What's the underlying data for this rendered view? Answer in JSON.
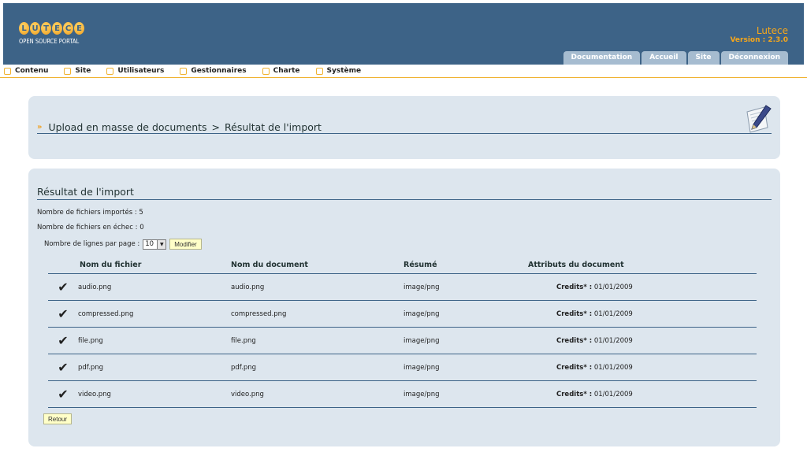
{
  "header": {
    "logo_letters": [
      "L",
      "U",
      "T",
      "E",
      "C",
      "E"
    ],
    "logo_sub": "OPEN SOURCE PORTAL",
    "site_name": "Lutece",
    "version": "Version : 2.3.0",
    "tabs": [
      {
        "label": "Documentation"
      },
      {
        "label": "Accueil"
      },
      {
        "label": "Site"
      },
      {
        "label": "Déconnexion"
      }
    ]
  },
  "menu": {
    "items": [
      {
        "label": "Contenu"
      },
      {
        "label": "Site"
      },
      {
        "label": "Utilisateurs"
      },
      {
        "label": "Gestionnaires"
      },
      {
        "label": "Charte"
      },
      {
        "label": "Système"
      }
    ]
  },
  "page": {
    "breadcrumb_root": "Upload en masse de documents",
    "breadcrumb_sep": ">",
    "breadcrumb_current": "Résultat de l'import"
  },
  "results": {
    "title": "Résultat de l'import",
    "imported_line": "Nombre de fichiers importés : 5",
    "failed_line": "Nombre de fichiers en échec : 0",
    "lines_per_page_label": "Nombre de lignes par page :",
    "lines_per_page_value": "10",
    "modifier_label": "Modifier",
    "retour_label": "Retour",
    "columns": [
      "Nom du fichier",
      "Nom du document",
      "Résumé",
      "Attributs du document"
    ],
    "rows": [
      {
        "file": "audio.png",
        "document": "audio.png",
        "summary": "image/png",
        "attr_label": "Credits* :",
        "attr_value": "01/01/2009"
      },
      {
        "file": "compressed.png",
        "document": "compressed.png",
        "summary": "image/png",
        "attr_label": "Credits* :",
        "attr_value": "01/01/2009"
      },
      {
        "file": "file.png",
        "document": "file.png",
        "summary": "image/png",
        "attr_label": "Credits* :",
        "attr_value": "01/01/2009"
      },
      {
        "file": "pdf.png",
        "document": "pdf.png",
        "summary": "image/png",
        "attr_label": "Credits* :",
        "attr_value": "01/01/2009"
      },
      {
        "file": "video.png",
        "document": "video.png",
        "summary": "image/png",
        "attr_label": "Credits* :",
        "attr_value": "01/01/2009"
      }
    ]
  },
  "icons": {
    "row_status": "checkmark-icon",
    "menu_item": "folder-icon",
    "title_arrow": "double-arrow-icon",
    "page_logo": "pen-paper-icon"
  },
  "colors": {
    "header_bg": "#3d6387",
    "accent": "#f0a020",
    "panel_bg": "#dde6ee",
    "tab_bg": "#a6bcd0"
  }
}
